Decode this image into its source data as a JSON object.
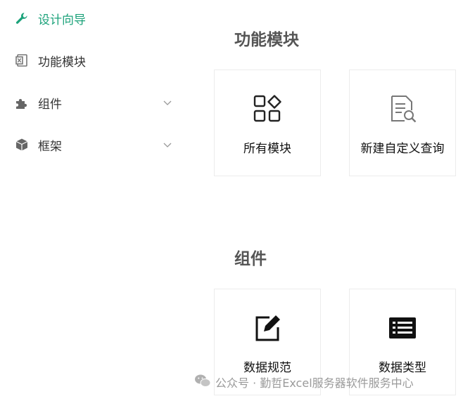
{
  "sidebar": {
    "items": [
      {
        "label": "设计向导",
        "icon": "wrench-icon",
        "active": true
      },
      {
        "label": "功能模块",
        "icon": "excel-file-icon"
      },
      {
        "label": "组件",
        "icon": "puzzle-icon",
        "expandable": true
      },
      {
        "label": "框架",
        "icon": "cube-icon",
        "expandable": true
      }
    ],
    "accent_color": "#1ba27a"
  },
  "main": {
    "sections": [
      {
        "title": "功能模块",
        "cards": [
          {
            "label": "所有模块",
            "icon": "apps-grid-icon"
          },
          {
            "label": "新建自定义查询",
            "icon": "document-search-icon"
          }
        ]
      },
      {
        "title": "组件",
        "cards": [
          {
            "label": "数据规范",
            "icon": "edit-icon"
          },
          {
            "label": "数据类型",
            "icon": "list-icon"
          }
        ]
      }
    ]
  },
  "watermark": {
    "text": "公众号 · 勤哲Excel服务器软件服务中心",
    "icon": "wechat-icon"
  }
}
